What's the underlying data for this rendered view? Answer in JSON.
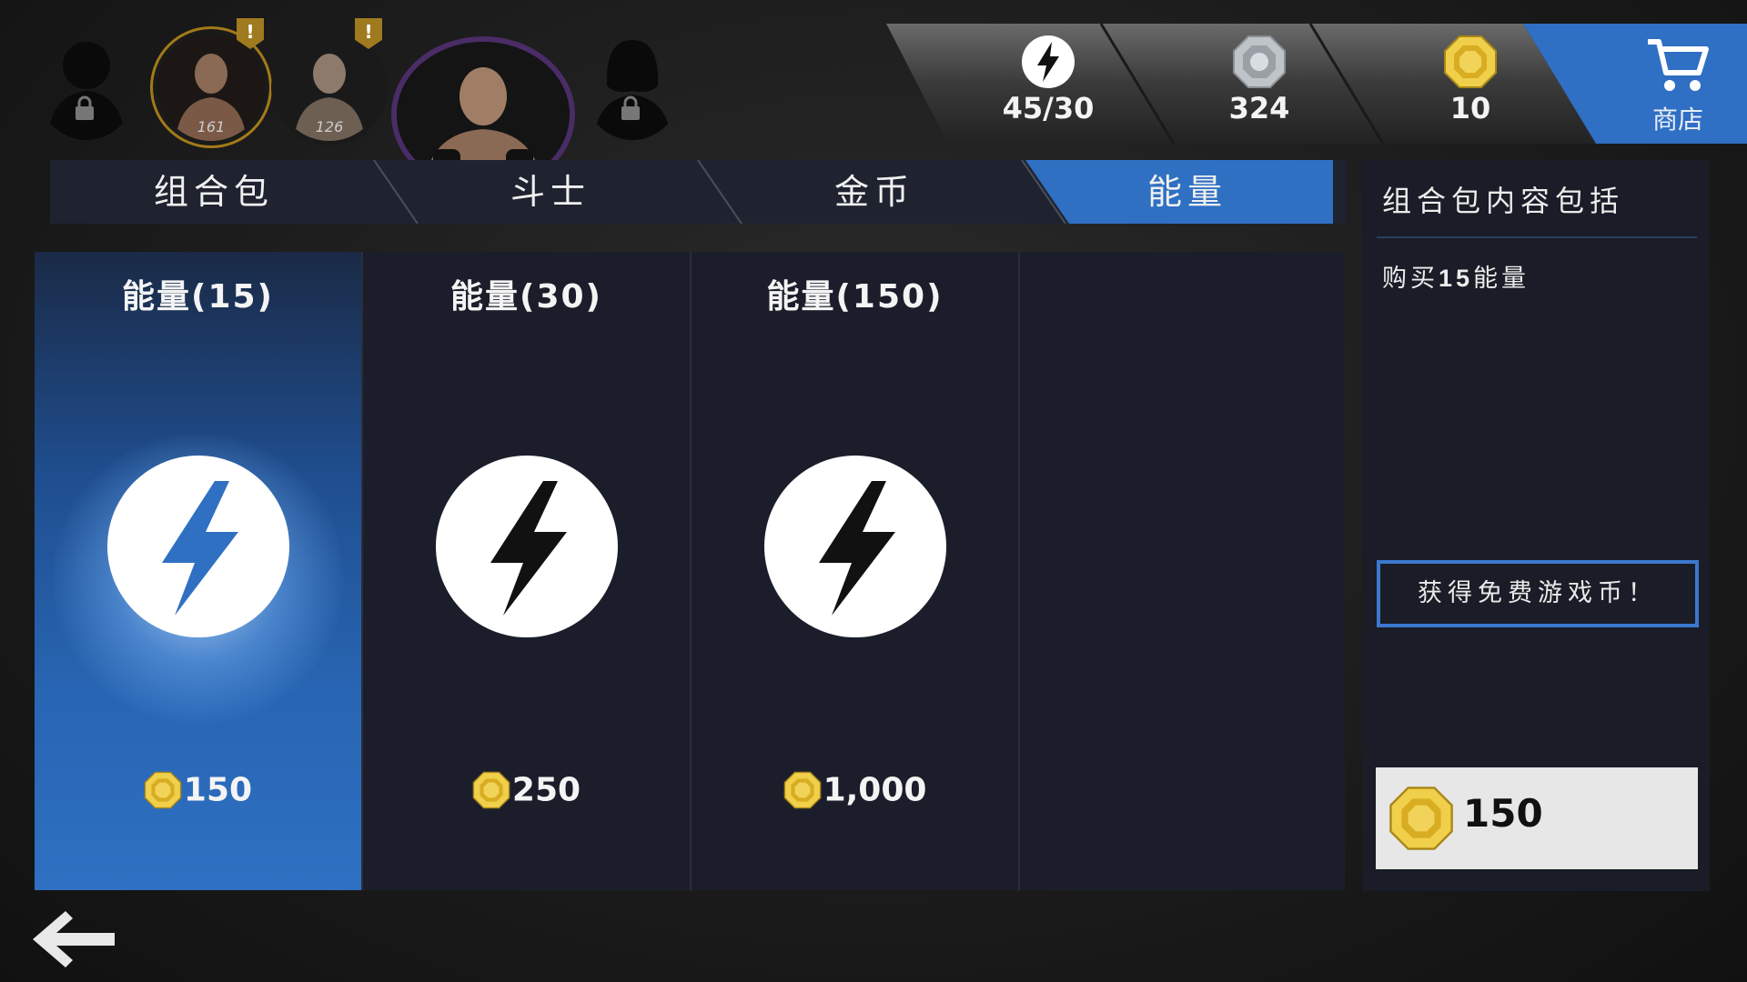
{
  "roster": {
    "fighters": [
      {
        "level": "161"
      },
      {
        "level": "126"
      }
    ],
    "alert_mark": "!"
  },
  "currencies": [
    {
      "icon": "energy-icon",
      "value": "45/30"
    },
    {
      "icon": "silver-chip-icon",
      "value": "324"
    },
    {
      "icon": "gold-coin-icon",
      "value": "10"
    }
  ],
  "shop": {
    "label": "商店",
    "icon": "shopping-cart-icon"
  },
  "tabs": [
    {
      "label": "组合包",
      "active": false
    },
    {
      "label": "斗士",
      "active": false
    },
    {
      "label": "金币",
      "active": false
    },
    {
      "label": "能量",
      "active": true
    }
  ],
  "products": [
    {
      "title": "能量(15)",
      "price": "150",
      "selected": true
    },
    {
      "title": "能量(30)",
      "price": "250",
      "selected": false
    },
    {
      "title": "能量(150)",
      "price": "1,000",
      "selected": false
    }
  ],
  "info_panel": {
    "title": "组合包内容包括",
    "description_prefix": "购买",
    "description_amount": "15",
    "description_suffix": "能量",
    "free_coins_label": "获得免费游戏币！",
    "buy_price": "150"
  },
  "colors": {
    "accent_blue": "#2f70c2",
    "gold": "#d8b43a",
    "card_bg": "#1b1e2a",
    "panel_bg": "#1a1d27"
  }
}
